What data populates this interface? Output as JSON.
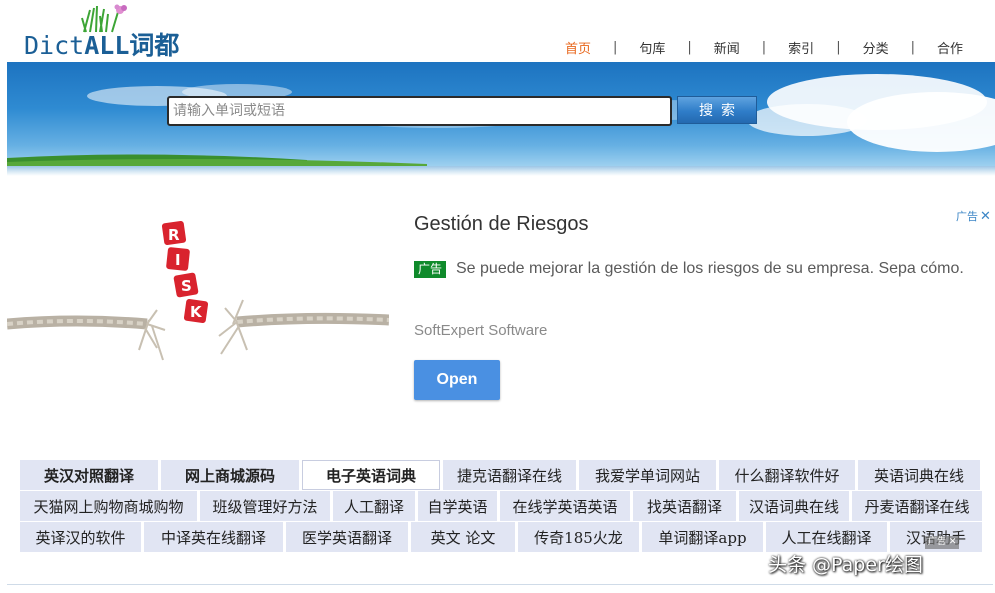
{
  "logo": {
    "text_latin": "Dict",
    "text_all": "ALL",
    "text_cn": "词都"
  },
  "nav": [
    {
      "label": "首页",
      "active": true
    },
    {
      "label": "句库",
      "active": false
    },
    {
      "label": "新闻",
      "active": false
    },
    {
      "label": "索引",
      "active": false
    },
    {
      "label": "分类",
      "active": false
    },
    {
      "label": "合作",
      "active": false
    }
  ],
  "nav_separator": "|",
  "search": {
    "placeholder": "请输入单词或短语",
    "value": "",
    "button_label": "搜索"
  },
  "ad": {
    "title": "Gestión de Riesgos",
    "badge": "广告",
    "description": "Se puede mejorar la gestión de los riesgos de su empresa. Sepa cómo.",
    "advertiser": "SoftExpert Software",
    "button_label": "Open",
    "choice_label": "广告",
    "choice_close": "✕",
    "image_letters": [
      "R",
      "I",
      "S",
      "K"
    ]
  },
  "links": [
    [
      "英汉对照翻译",
      "网上商城源码",
      "电子英语词典",
      "捷克语翻译在线",
      "我爱学单词网站",
      "什么翻译软件好",
      "英语词典在线"
    ],
    [
      "天猫网上购物商城购物",
      "班级管理好方法",
      "人工翻译",
      "自学英语",
      "在线学英语英语",
      "找英语翻译",
      "汉语词典在线",
      "丹麦语翻译在线"
    ],
    [
      "英译汉的软件",
      "中译英在线翻译",
      "医学英语翻译",
      "英文 论文",
      "传奇185火龙",
      "单词翻译app",
      "人工在线翻译",
      "汉语助手"
    ]
  ],
  "mini_ad": {
    "label": "广告",
    "close": "✕"
  },
  "watermark": "头条 @Paper绘图",
  "colors": {
    "active_nav": "#e8681e",
    "link_bg": "#e1e5f3",
    "ad_button": "#4a90e2",
    "ad_badge": "#0f8a2b"
  }
}
